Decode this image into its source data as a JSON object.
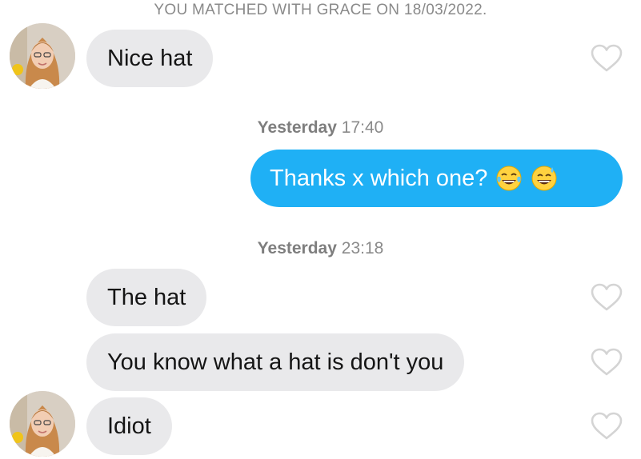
{
  "match_banner": "YOU MATCHED WITH GRACE ON 18/03/2022.",
  "messages": [
    {
      "text": "Nice hat"
    },
    {
      "text": "Thanks x which one?"
    },
    {
      "text": "The hat"
    },
    {
      "text": "You know what a hat is don't you"
    },
    {
      "text": "Idiot"
    }
  ],
  "timestamps": [
    {
      "day": "Yesterday",
      "time": "17:40"
    },
    {
      "day": "Yesterday",
      "time": "23:18"
    }
  ],
  "icons": {
    "avatar": "grace-avatar",
    "like": "heart-outline-icon",
    "emoji_1": "face-with-tears-of-joy-emoji",
    "emoji_2": "grinning-face-with-sweat-emoji"
  },
  "colors": {
    "sent_bubble": "#1fb0f5",
    "received_bubble": "#e9e9eb",
    "meta_text": "#8a8a8a",
    "heart_outline": "#d4d4d4"
  }
}
